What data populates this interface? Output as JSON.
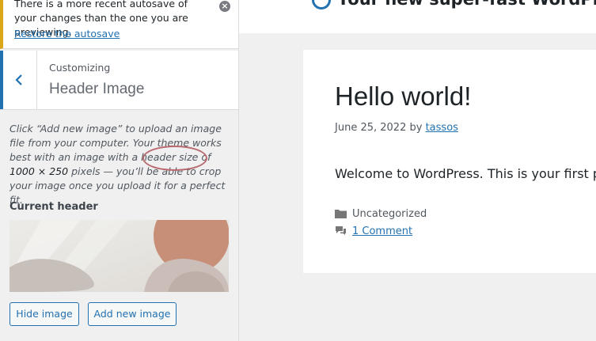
{
  "notice": {
    "text": "There is a more recent autosave of your changes than the one you are previewing.",
    "restore_link": "Restore the autosave"
  },
  "section": {
    "eyebrow": "Customizing",
    "title": "Header Image"
  },
  "description": {
    "before": "Click “Add new image” to upload an image file from your computer. Your theme works best with an image with a header size of ",
    "size": "1000 × 250",
    "after": " pixels — you’ll be able to crop your image once you upload it for a perfect fit."
  },
  "current_header": {
    "label": "Current header"
  },
  "buttons": {
    "hide_image": "Hide image",
    "add_new_image": "Add new image"
  },
  "preview": {
    "site_title": "Your new super-fast WordPress",
    "post": {
      "title": "Hello world!",
      "date": "June 25, 2022",
      "by": "by",
      "author": "tassos",
      "excerpt": "Welcome to WordPress. This is your first post.",
      "category": "Uncategorized",
      "comments": "1 Comment"
    }
  },
  "colors": {
    "accent": "#2271b1",
    "notice_warning": "#dba617",
    "annotation_circle": "#b96a6f"
  }
}
